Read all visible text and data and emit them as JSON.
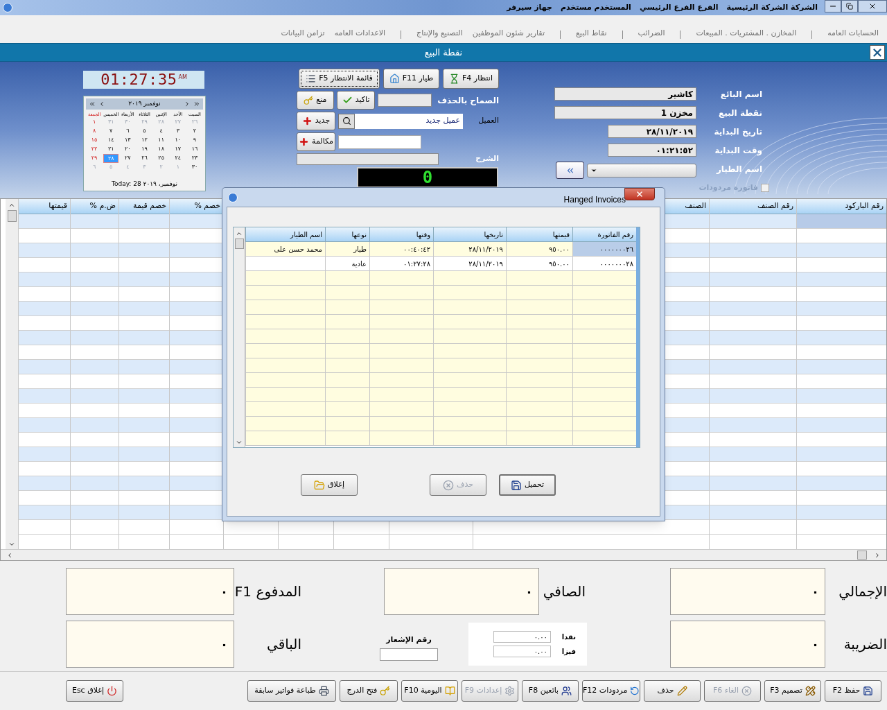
{
  "title_bar": {
    "items": [
      "الشركة الشركة الرئيسية",
      "الفرع الفرع الرئيسي",
      "المستخدم مستخدم",
      "جهاز سيرفر"
    ]
  },
  "menu_groups": [
    {
      "items": [
        "الحسابات العامه"
      ]
    },
    {
      "items": [
        "المخازن . المشتريات . المبيعات"
      ]
    },
    {
      "items": [
        "الضرائب"
      ]
    },
    {
      "items": [
        "نقاط البيع"
      ]
    },
    {
      "items": [
        "تقارير شئون الموظفين",
        "التصنيع والإنتاج"
      ]
    },
    {
      "items": [
        "الاعدادات العامه",
        "تزامن البيانات"
      ]
    }
  ],
  "window": {
    "title": "نقطة البيع"
  },
  "info_fields": [
    {
      "label": "اسم البائع",
      "value": "كاشير",
      "kind": "wide"
    },
    {
      "label": "نقطة البيع",
      "value": "مخزن 1",
      "kind": "wide"
    },
    {
      "label": "تاريخ البداية",
      "value": "٢٨/١١/٢٠١٩",
      "kind": "short"
    },
    {
      "label": "وقت البداية",
      "value": "٠١:٢١:٥٢",
      "kind": "short"
    },
    {
      "label": "اسم الطيار",
      "kind": "dropdown"
    }
  ],
  "returns_checkbox": {
    "label": "فاتورة مردودات",
    "checked": false,
    "disabled": true
  },
  "top_buttons": [
    {
      "label": "انتظار F4",
      "focused": false
    },
    {
      "label": "طيار F11",
      "focused": false
    },
    {
      "label": "قائمة الانتظار F5",
      "focused": true
    }
  ],
  "delete_permission": {
    "label": "الصماح بالحذف",
    "confirm": "تاكيد",
    "deny": "منع"
  },
  "customer": {
    "label": "العميل",
    "value": "عميل جديد",
    "new_button": "جديد"
  },
  "call": {
    "button": "مكالمة"
  },
  "notes": {
    "label": "الشرح"
  },
  "display": "0",
  "clock": {
    "time": "01:27:35",
    "suffix": "AM"
  },
  "calendar": {
    "month": "نوفمبر ٢٠١٩",
    "days": [
      "السبت",
      "الأحد",
      "الإثنين",
      "الثلاثاء",
      "الأربعاء",
      "الخميس",
      "الجمعة"
    ],
    "weeks": [
      [
        {
          "d": "٢٦",
          "muted": true,
          "selected": false
        },
        {
          "d": "٢٧",
          "muted": true,
          "selected": false
        },
        {
          "d": "٢٨",
          "muted": true,
          "selected": false
        },
        {
          "d": "٢٩",
          "muted": true,
          "selected": false
        },
        {
          "d": "٣٠",
          "muted": true,
          "selected": false
        },
        {
          "d": "٣١",
          "muted": true,
          "selected": false
        },
        {
          "d": "١",
          "muted": false,
          "selected": false
        }
      ],
      [
        {
          "d": "٢",
          "muted": false,
          "selected": false
        },
        {
          "d": "٣",
          "muted": false,
          "selected": false
        },
        {
          "d": "٤",
          "muted": false,
          "selected": false
        },
        {
          "d": "٥",
          "muted": false,
          "selected": false
        },
        {
          "d": "٦",
          "muted": false,
          "selected": false
        },
        {
          "d": "٧",
          "muted": false,
          "selected": false
        },
        {
          "d": "٨",
          "muted": false,
          "selected": false
        }
      ],
      [
        {
          "d": "٩",
          "muted": false,
          "selected": false
        },
        {
          "d": "١٠",
          "muted": false,
          "selected": false
        },
        {
          "d": "١١",
          "muted": false,
          "selected": false
        },
        {
          "d": "١٢",
          "muted": false,
          "selected": false
        },
        {
          "d": "١٣",
          "muted": false,
          "selected": false
        },
        {
          "d": "١٤",
          "muted": false,
          "selected": false
        },
        {
          "d": "١٥",
          "muted": false,
          "selected": false
        }
      ],
      [
        {
          "d": "١٦",
          "muted": false,
          "selected": false
        },
        {
          "d": "١٧",
          "muted": false,
          "selected": false
        },
        {
          "d": "١٨",
          "muted": false,
          "selected": false
        },
        {
          "d": "١٩",
          "muted": false,
          "selected": false
        },
        {
          "d": "٢٠",
          "muted": false,
          "selected": false
        },
        {
          "d": "٢١",
          "muted": false,
          "selected": false
        },
        {
          "d": "٢٢",
          "muted": false,
          "selected": false
        }
      ],
      [
        {
          "d": "٢٣",
          "muted": false,
          "selected": false
        },
        {
          "d": "٢٤",
          "muted": false,
          "selected": false
        },
        {
          "d": "٢٥",
          "muted": false,
          "selected": false
        },
        {
          "d": "٢٦",
          "muted": false,
          "selected": false
        },
        {
          "d": "٢٧",
          "muted": false,
          "selected": false
        },
        {
          "d": "٢٨",
          "muted": false,
          "selected": true
        },
        {
          "d": "٢٩",
          "muted": false,
          "selected": false
        }
      ],
      [
        {
          "d": "٣٠",
          "muted": false,
          "selected": false
        },
        {
          "d": "١",
          "muted": true,
          "selected": false
        },
        {
          "d": "٢",
          "muted": true,
          "selected": false
        },
        {
          "d": "٣",
          "muted": true,
          "selected": false
        },
        {
          "d": "٤",
          "muted": true,
          "selected": false
        },
        {
          "d": "٥",
          "muted": true,
          "selected": false
        },
        {
          "d": "٦",
          "muted": true,
          "selected": false
        }
      ]
    ],
    "today": "Today: 28 نوفمبر، ٢٠١٩"
  },
  "grid": {
    "columns": [
      {
        "label": "رقم الباركود"
      },
      {
        "label": "رقم الصنف"
      },
      {
        "label": "الصنف"
      },
      {},
      {},
      {},
      {},
      {
        "label": "خصم %"
      },
      {
        "label": "خصم قيمة"
      },
      {
        "label": "ض.م %"
      },
      {
        "label": "قيمتها"
      }
    ]
  },
  "dialog": {
    "title": "Hanged Invoices",
    "columns": [
      "رقم الفاتورة",
      "قيمتها",
      "تاريخها",
      "وقتها",
      "نوعها",
      "اسم الطيار"
    ],
    "rows": [
      {
        "selected": true,
        "cells": [
          "٠٠٠٠٠٠٠٢٦",
          "٩٥٠.٠٠",
          "٢٨/١١/٢٠١٩",
          "٠٠:٤٠:٤٢",
          "طيار",
          "محمد حسن على"
        ]
      },
      {
        "selected": false,
        "cells": [
          "٠٠٠٠٠٠٠٢٨",
          "٩٥٠.٠٠",
          "٢٨/١١/٢٠١٩",
          "٠١:٢٧:٢٨",
          "عادية"
        ]
      }
    ],
    "buttons": [
      {
        "label": "تحميل",
        "kind": "load",
        "disabled": false
      },
      {
        "label": "حذف",
        "kind": "delete",
        "disabled": true
      },
      {
        "label": "إغلاق",
        "kind": "close",
        "disabled": false
      }
    ]
  },
  "totals": {
    "total": {
      "label": "الإجمالي",
      "value": "٠"
    },
    "net": {
      "label": "الصافي",
      "value": "٠"
    },
    "paid": {
      "label": "المدفوع F1",
      "value": "٠"
    },
    "tax": {
      "label": "الضريبة",
      "value": "٠"
    },
    "remaining": {
      "label": "الباقي",
      "value": "٠"
    },
    "notice": {
      "label": "رقم الإشعار"
    },
    "cash": {
      "label": "نقدا",
      "value": "٠.٠٠"
    },
    "visa": {
      "label": "فيزا",
      "value": "٠.٠٠"
    }
  },
  "toolbar": [
    {
      "label": "حفظ F2",
      "kind": "save",
      "disabled": false
    },
    {
      "label": "تصميم F3",
      "kind": "design",
      "disabled": false
    },
    {
      "label": "الغاء F6",
      "kind": "cancel",
      "disabled": true
    },
    {
      "label": "حذف",
      "kind": "edit",
      "disabled": false
    },
    {
      "label": "مردودات F12",
      "kind": "returns",
      "disabled": false
    },
    {
      "label": "بائعين F8",
      "kind": "sellers",
      "disabled": false
    },
    {
      "label": "إعدادات F9",
      "kind": "settings",
      "disabled": true
    },
    {
      "label": "اليومية F10",
      "kind": "journal",
      "disabled": false
    },
    {
      "label": "فتح الدرج",
      "kind": "drawer",
      "disabled": false
    },
    {
      "label": "طباعة فواتير سابقة",
      "kind": "print",
      "disabled": false
    },
    {
      "label": "إغلاق Esc",
      "kind": "exit",
      "disabled": false
    }
  ]
}
